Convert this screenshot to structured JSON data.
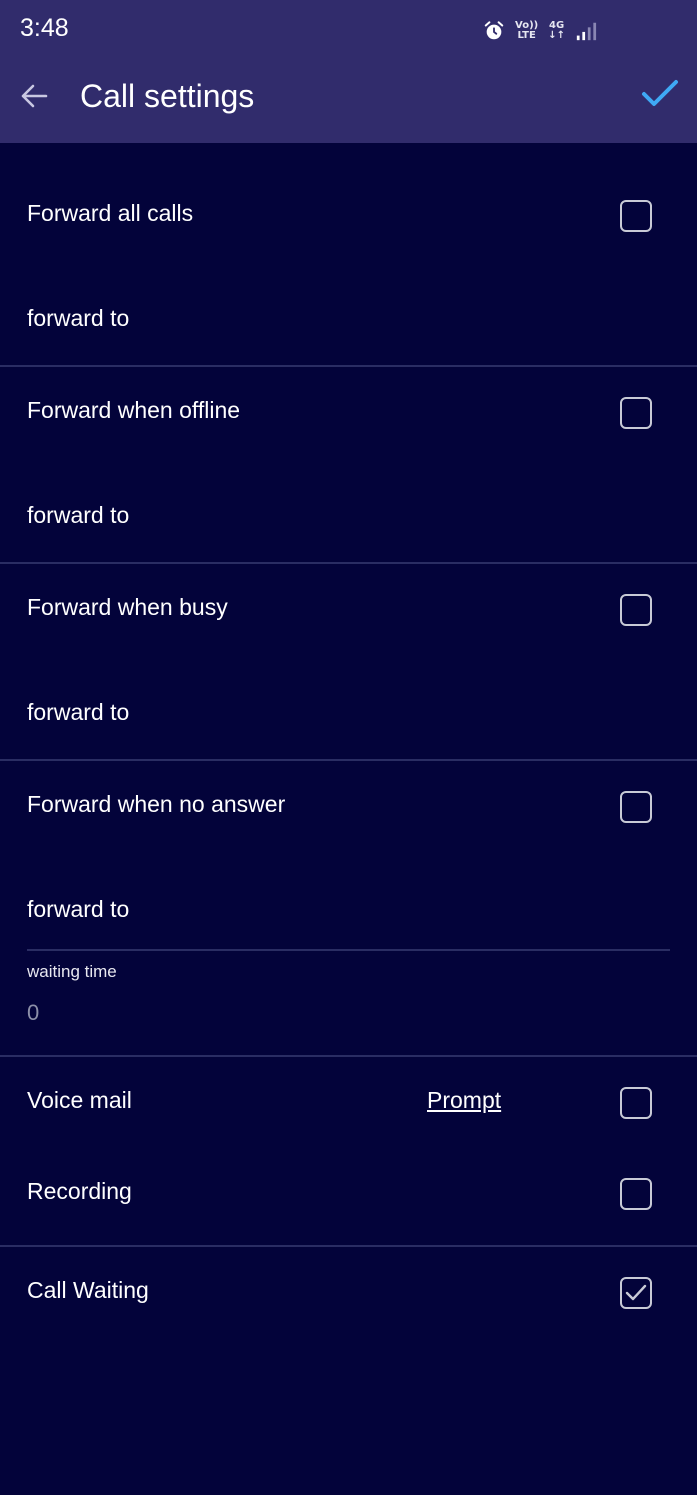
{
  "status_bar": {
    "time": "3:48",
    "net_top_left": "Vo))",
    "net_bottom_left": "LTE",
    "net_top_right": "4G",
    "net_bottom_right": "↓↑",
    "icons": [
      "alarm-icon",
      "signal-icon"
    ]
  },
  "header": {
    "title": "Call settings",
    "back_icon": "arrow-left-icon",
    "confirm_icon": "check-icon",
    "background": "#312c6c",
    "accent": "#3fa9f5"
  },
  "forward_rules": [
    {
      "label": "Forward all calls",
      "field_placeholder": "forward to",
      "checked": false
    },
    {
      "label": "Forward when offline",
      "field_placeholder": "forward to",
      "checked": false
    },
    {
      "label": "Forward when busy",
      "field_placeholder": "forward to",
      "checked": false
    },
    {
      "label": "Forward when no answer",
      "field_placeholder": "forward to",
      "checked": false
    }
  ],
  "waiting_time": {
    "label": "waiting time",
    "value": "0"
  },
  "voice_mail": {
    "label": "Voice mail",
    "link": "Prompt",
    "checked": false
  },
  "recording": {
    "label": "Recording",
    "checked": false
  },
  "call_waiting": {
    "label": "Call Waiting",
    "checked": true
  },
  "colors": {
    "background": "#03033a",
    "divider": "#2a2d63"
  }
}
